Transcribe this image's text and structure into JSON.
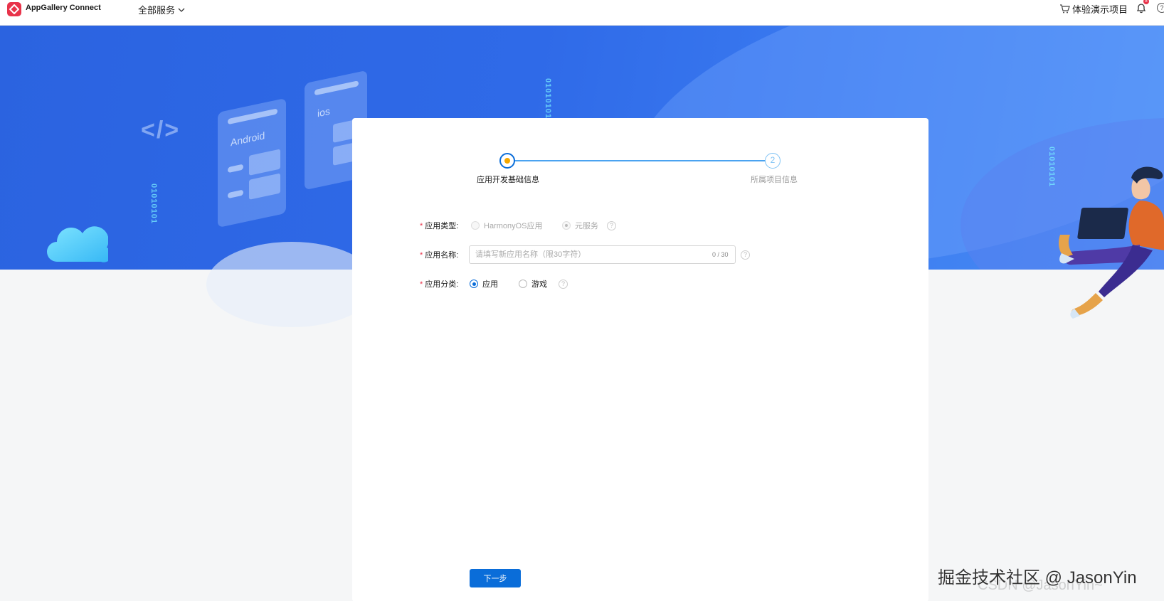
{
  "header": {
    "brand": "AppGallery Connect",
    "services_menu": "全部服务",
    "demo_project": "体验演示项目",
    "notification_count": "8",
    "help": "?"
  },
  "banner": {
    "code_symbol": "</>",
    "card_android": "Android",
    "card_ios": "ios",
    "bits": "01010101"
  },
  "steps": [
    {
      "label": "应用开发基础信息",
      "status": "active"
    },
    {
      "label": "所属项目信息",
      "number": "2",
      "status": "pending"
    }
  ],
  "form": {
    "app_type": {
      "label": "应用类型:",
      "options": [
        {
          "label": "HarmonyOS应用",
          "checked": false,
          "disabled": true
        },
        {
          "label": "元服务",
          "checked": true,
          "disabled": true
        }
      ]
    },
    "app_name": {
      "label": "应用名称:",
      "placeholder": "请填写新应用名称（限30字符）",
      "value": "",
      "counter": "0 / 30"
    },
    "app_category": {
      "label": "应用分类:",
      "options": [
        {
          "label": "应用",
          "checked": true
        },
        {
          "label": "游戏",
          "checked": false
        }
      ]
    },
    "required_mark": "*",
    "help_mark": "?"
  },
  "actions": {
    "next": "下一步"
  },
  "watermark": {
    "main": "掘金技术社区 @ JasonYin",
    "sub": "CSDN @JasonYin~"
  },
  "colors": {
    "primary": "#0A6DD9",
    "brand_red": "#E8334A",
    "banner_blue": "#2F6AE8",
    "step_active_dot": "#F5A800"
  }
}
